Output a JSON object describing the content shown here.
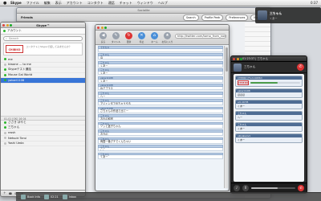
{
  "menubar": {
    "apple": "",
    "app": "Skype",
    "items": [
      "ファイル",
      "編集",
      "表示",
      "アカウント",
      "コンタクト",
      "通話",
      "チャット",
      "ウィンドウ",
      "ヘルプ"
    ],
    "clock": "0:37"
  },
  "mainwin": {
    "title": "Socialite",
    "nav": "Friends",
    "buttons": [
      "Search",
      "Profile Peek",
      "Preferences",
      "Mark All"
    ],
    "left": [
      "Unread",
      "All",
      "Twitter"
    ]
  },
  "skype": {
    "title": "Skype™",
    "user": "アカウント",
    "search_placeholder": "Search",
    "ad_logo": "CHIBIKO",
    "ad_text": "コンタクトとSkypeで話してみませんか？",
    "contacts": [
      {
        "name": "me",
        "online": true,
        "selected": false
      },
      {
        "name": "kiwane ... to me",
        "online": false,
        "selected": false
      },
      {
        "name": "Skypeテスト通話",
        "online": true,
        "selected": false
      },
      {
        "name": "Mouse Gal World",
        "online": true,
        "selected": false
      },
      {
        "name": "yakari1108",
        "online": true,
        "selected": true
      }
    ],
    "section": "01-01 [OK] 16 04",
    "contacts2": [
      {
        "name": "ささき ほやと",
        "online": true
      },
      {
        "name": "三ちゃん",
        "online": true
      },
      {
        "name": "nwsh",
        "online": false
      },
      {
        "name": "Netsuki Tarui",
        "online": false
      },
      {
        "name": "Yoshi Ueda",
        "online": false
      }
    ],
    "footer": "Skype"
  },
  "twit": {
    "title": "",
    "tools": [
      "戻る",
      "タイトル",
      "更新",
      "停止",
      "ホーム",
      "お気に入り"
    ],
    "url": "http://twitter.com/tomo_from_now/s/",
    "tweets": [
      {
        "h": "できちゃ",
        "b": ""
      },
      {
        "h": "三ちゃん",
        "b": "😊"
      },
      {
        "h": "三ちゃん",
        "b": "くあー"
      },
      {
        "h": "三ちゃん",
        "b": "くあー"
      },
      {
        "h": "yakari1108",
        "b": "くあー"
      },
      {
        "h": "yakari1108",
        "b": "ねアブラス"
      },
      {
        "h": "三ちゃん",
        "b": "へー"
      },
      {
        "h": "三ちゃん",
        "b": "アジェンタで出ちゃうやる"
      },
      {
        "h": "yakari1108",
        "b": "さちゃんの作品で出てー"
      },
      {
        "h": "三ちゃん",
        "b": "おれの和宮"
      },
      {
        "h": "三ちゃん",
        "b": "ゾッと迷子ちゃん"
      },
      {
        "h": "三ちゃん",
        "b": "お元の"
      },
      {
        "h": "三ちゃん",
        "b": "両国一番グチでくんちゃい"
      },
      {
        "h": "三ちゃん",
        "b": "ここ"
      },
      {
        "h": "三ちゃん",
        "b": "くあー"
      }
    ]
  },
  "chat": {
    "title": "01:23:37 | 三ちゃん",
    "avatar_label": "三ちゃん",
    "messages": [
      {
        "h": "CHIBIKO (From KOMU)",
        "b": "",
        "card": true,
        "logo": "CHIBIKO",
        "progress": 0.55
      },
      {
        "h": "yakari1108",
        "b": "ほほほ"
      },
      {
        "h": "am 10:55",
        "b": "くあー"
      },
      {
        "h": "三ちゃん",
        "b": "へー"
      },
      {
        "h": "三ちゃん",
        "b": "くあー"
      },
      {
        "h": "ukiyakariv1",
        "b": "くあー"
      }
    ],
    "volume": 0.6
  },
  "notif": {
    "name": "三ちゃん",
    "message": "くあー"
  },
  "dock": {
    "items": [
      "Book Info",
      "02:21",
      "Inbox"
    ]
  }
}
